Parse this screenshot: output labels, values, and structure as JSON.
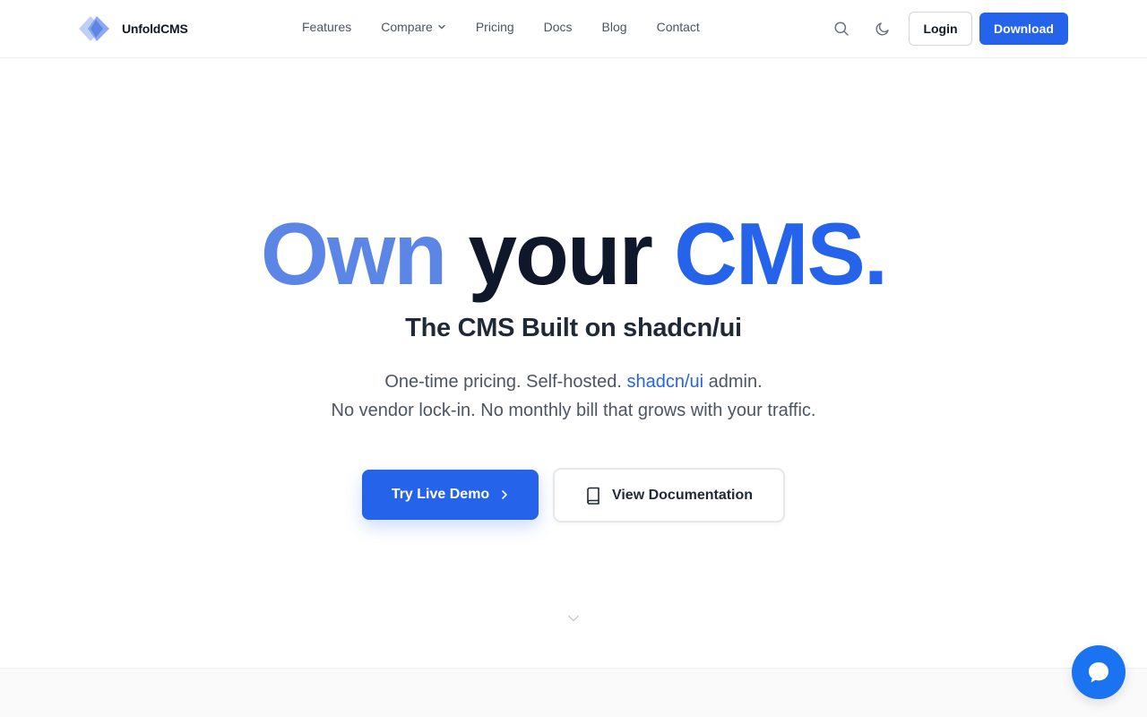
{
  "brand": {
    "name": "UnfoldCMS"
  },
  "nav": {
    "items": [
      {
        "label": "Features"
      },
      {
        "label": "Compare",
        "has_dropdown": true
      },
      {
        "label": "Pricing"
      },
      {
        "label": "Docs"
      },
      {
        "label": "Blog"
      },
      {
        "label": "Contact"
      }
    ]
  },
  "header_actions": {
    "search_icon": "search-icon",
    "theme_icon": "moon-icon",
    "login_label": "Login",
    "download_label": "Download"
  },
  "hero": {
    "title_word_1": "Own",
    "title_word_2": "your",
    "title_word_3": "CMS",
    "title_period": ".",
    "subtitle": "The CMS Built on shadcn/ui",
    "desc_line1_start": "One-time pricing. Self-hosted. ",
    "desc_link": "shadcn/ui",
    "desc_line1_end": " admin.",
    "desc_line2": "No vendor lock-in. No monthly bill that grows with your traffic.",
    "primary_cta": "Try Live Demo",
    "secondary_cta": "View Documentation"
  },
  "colors": {
    "primary": "#2563eb",
    "title_light_blue": "#5b86e5",
    "title_dark": "#0f172a",
    "chat": "#1a73f0"
  }
}
